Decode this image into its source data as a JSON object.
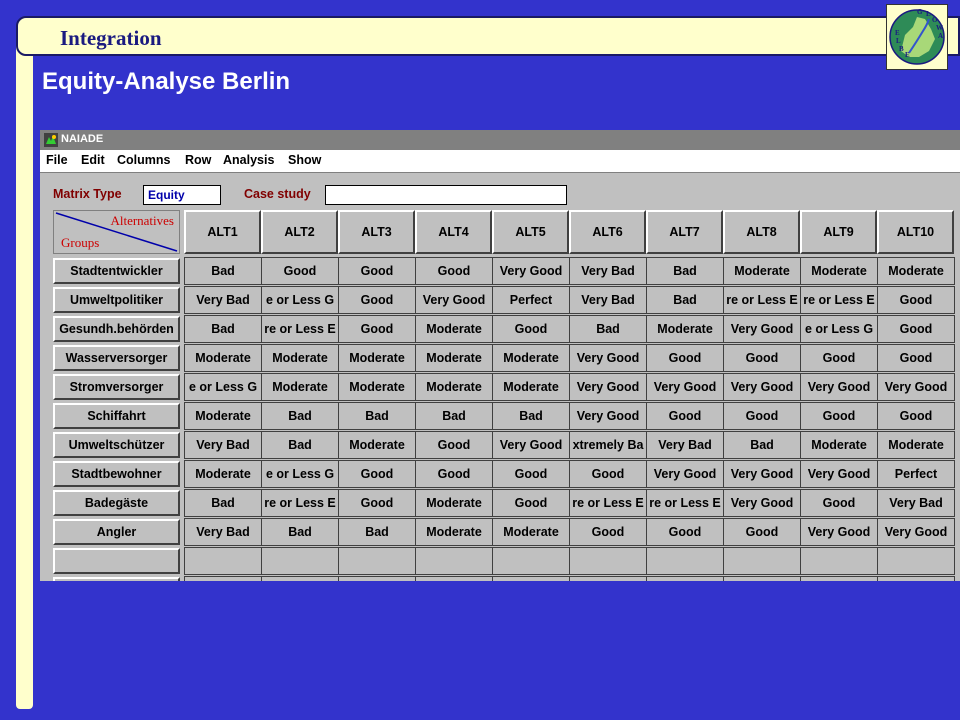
{
  "slide": {
    "section": "Integration",
    "title": "Equity-Analyse Berlin",
    "logo_letters": [
      "G",
      "L",
      "O",
      "W",
      "A",
      "E",
      "L",
      "B",
      "E"
    ]
  },
  "window": {
    "title": "NAIADE",
    "menu": [
      "File",
      "Edit",
      "Columns",
      "Row",
      "Analysis",
      "Show"
    ],
    "matrix_type_label": "Matrix Type",
    "matrix_type_value": "Equity",
    "case_study_label": "Case study",
    "case_study_value": ""
  },
  "matrix": {
    "corner_alternatives": "Alternatives",
    "corner_groups": "Groups",
    "columns": [
      "ALT1",
      "ALT2",
      "ALT3",
      "ALT4",
      "ALT5",
      "ALT6",
      "ALT7",
      "ALT8",
      "ALT9",
      "ALT10"
    ],
    "rows": [
      {
        "group": "Stadtentwickler",
        "values": [
          "Bad",
          "Good",
          "Good",
          "Good",
          "Very Good",
          "Very Bad",
          "Bad",
          "Moderate",
          "Moderate",
          "Moderate"
        ]
      },
      {
        "group": "Umweltpolitiker",
        "values": [
          "Very Bad",
          "e or Less G",
          "Good",
          "Very Good",
          "Perfect",
          "Very Bad",
          "Bad",
          "re or Less E",
          "re or Less E",
          "Good"
        ]
      },
      {
        "group": "Gesundh.behörden",
        "values": [
          "Bad",
          "re or Less E",
          "Good",
          "Moderate",
          "Good",
          "Bad",
          "Moderate",
          "Very Good",
          "e or Less G",
          "Good"
        ]
      },
      {
        "group": "Wasserversorger",
        "values": [
          "Moderate",
          "Moderate",
          "Moderate",
          "Moderate",
          "Moderate",
          "Very Good",
          "Good",
          "Good",
          "Good",
          "Good"
        ]
      },
      {
        "group": "Stromversorger",
        "values": [
          "e or Less G",
          "Moderate",
          "Moderate",
          "Moderate",
          "Moderate",
          "Very Good",
          "Very Good",
          "Very Good",
          "Very Good",
          "Very Good"
        ]
      },
      {
        "group": "Schiffahrt",
        "values": [
          "Moderate",
          "Bad",
          "Bad",
          "Bad",
          "Bad",
          "Very Good",
          "Good",
          "Good",
          "Good",
          "Good"
        ]
      },
      {
        "group": "Umweltschützer",
        "values": [
          "Very Bad",
          "Bad",
          "Moderate",
          "Good",
          "Very Good",
          "xtremely Ba",
          "Very Bad",
          "Bad",
          "Moderate",
          "Moderate"
        ]
      },
      {
        "group": "Stadtbewohner",
        "values": [
          "Moderate",
          "e or Less G",
          "Good",
          "Good",
          "Good",
          "Good",
          "Very Good",
          "Very Good",
          "Very Good",
          "Perfect"
        ]
      },
      {
        "group": "Badegäste",
        "values": [
          "Bad",
          "re or Less E",
          "Good",
          "Moderate",
          "Good",
          "re or Less E",
          "re or Less E",
          "Very Good",
          "Good",
          "Very Bad"
        ]
      },
      {
        "group": "Angler",
        "values": [
          "Very Bad",
          "Bad",
          "Bad",
          "Moderate",
          "Moderate",
          "Good",
          "Good",
          "Good",
          "Very Good",
          "Very Good"
        ]
      },
      {
        "group": "",
        "values": [
          "",
          "",
          "",
          "",
          "",
          "",
          "",
          "",
          "",
          ""
        ]
      },
      {
        "group": "",
        "values": [
          "",
          "",
          "",
          "",
          "",
          "",
          "",
          "",
          "",
          ""
        ]
      }
    ]
  }
}
